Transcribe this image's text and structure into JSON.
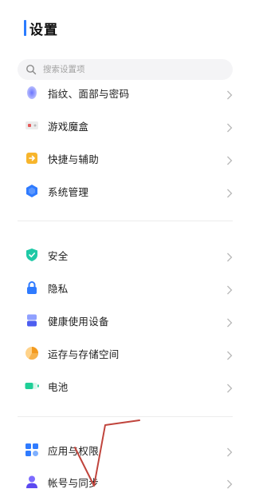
{
  "header": {
    "title": "设置"
  },
  "search": {
    "placeholder": "搜索设置项"
  },
  "groups": [
    {
      "items": [
        {
          "label": "指纹、面部与密码",
          "icon": "fingerprint-icon"
        },
        {
          "label": "游戏魔盒",
          "icon": "game-box-icon"
        },
        {
          "label": "快捷与辅助",
          "icon": "shortcut-icon"
        },
        {
          "label": "系统管理",
          "icon": "system-management-icon"
        }
      ]
    },
    {
      "items": [
        {
          "label": "安全",
          "icon": "shield-icon"
        },
        {
          "label": "隐私",
          "icon": "lock-icon"
        },
        {
          "label": "健康使用设备",
          "icon": "hourglass-icon"
        },
        {
          "label": "运存与存储空间",
          "icon": "storage-pie-icon"
        },
        {
          "label": "电池",
          "icon": "battery-icon"
        }
      ]
    },
    {
      "items": [
        {
          "label": "应用与权限",
          "icon": "apps-icon"
        },
        {
          "label": "帐号与同步",
          "icon": "account-icon"
        }
      ]
    }
  ],
  "colors": {
    "accent": "#2b7cff",
    "background": "#ffffff",
    "annotation_stroke": "#c0443c"
  }
}
